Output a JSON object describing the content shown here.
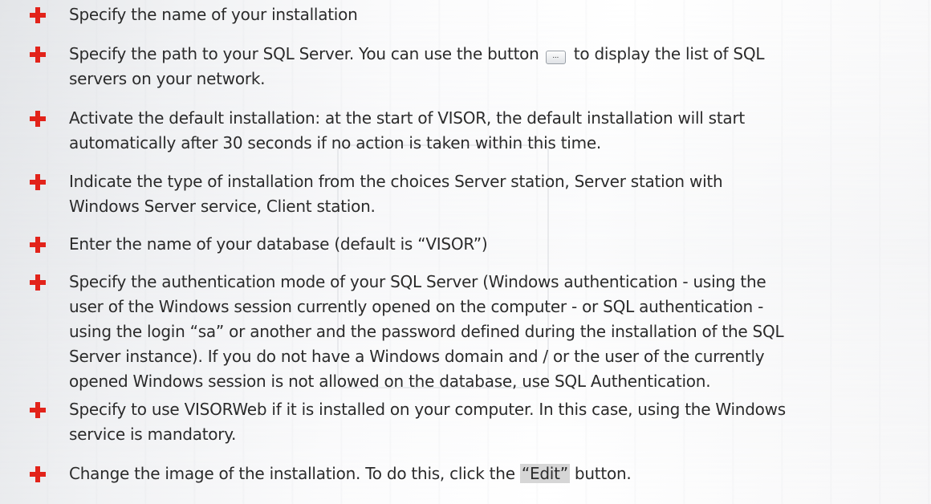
{
  "bullets": [
    {
      "lines": [
        "Specify the name of your installation"
      ]
    },
    {
      "lines": [
        "Specify the path to your SQL Server. You can use the button",
        "to display the list of SQL",
        "servers on your network."
      ],
      "inline_button_label": "..."
    },
    {
      "lines": [
        "Activate the default installation: at the start of VISOR, the default installation will start",
        "automatically after 30 seconds if no action is taken within this time."
      ]
    },
    {
      "lines": [
        "Indicate the type of installation from the choices Server station, Server station with",
        "Windows Server service, Client station."
      ]
    },
    {
      "lines": [
        "Enter the name of your database (default is “VISOR”)"
      ]
    },
    {
      "lines": [
        "Specify the authentication mode of your SQL Server (Windows authentication - using the",
        "user of the Windows session currently opened on the computer - or SQL authentication -",
        "using the login “sa” or another and the password defined during the installation of the SQL",
        "Server instance). If you do not have a Windows domain and / or the user of the currently",
        "opened Windows session is not allowed on the database, use SQL Authentication."
      ]
    },
    {
      "lines": [
        "Specify to use VISORWeb if it is installed on your computer. In this case, using the Windows",
        "service is mandatory."
      ]
    },
    {
      "lines": [
        "Change the image of the installation. To do this, click the",
        "“Edit”",
        "button."
      ]
    }
  ],
  "icon": {
    "name": "red-cross-bullet-icon",
    "color": "#e2231a"
  }
}
